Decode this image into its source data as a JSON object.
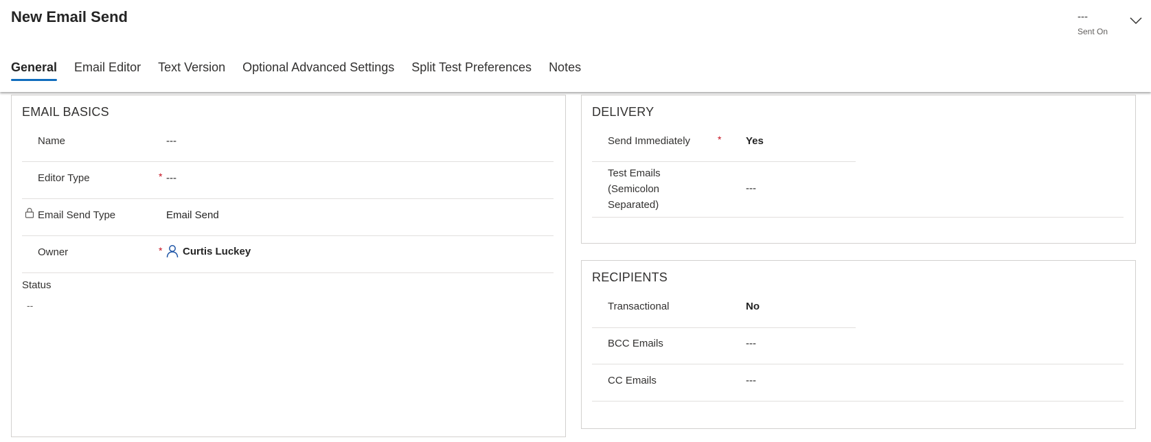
{
  "header": {
    "title": "New Email Send",
    "sent_on_value": "---",
    "sent_on_label": "Sent On",
    "expand_icon": "chevron-down-icon"
  },
  "tabs": [
    {
      "label": "General",
      "active": true
    },
    {
      "label": "Email Editor"
    },
    {
      "label": "Text Version"
    },
    {
      "label": "Optional Advanced Settings"
    },
    {
      "label": "Split Test Preferences"
    },
    {
      "label": "Notes"
    }
  ],
  "email_basics": {
    "title": "EMAIL BASICS",
    "name_label": "Name",
    "name_value": "---",
    "editor_type_label": "Editor Type",
    "editor_type_required": "*",
    "editor_type_value": "---",
    "email_send_type_label": "Email Send Type",
    "email_send_type_value": "Email Send",
    "owner_label": "Owner",
    "owner_required": "*",
    "owner_value": "Curtis Luckey",
    "status_label": "Status",
    "status_value": "--"
  },
  "delivery": {
    "title": "DELIVERY",
    "send_immediately_label": "Send Immediately",
    "send_immediately_required": "*",
    "send_immediately_value": "Yes",
    "test_emails_label_1": "Test Emails",
    "test_emails_label_2": "(Semicolon",
    "test_emails_label_3": "Separated)",
    "test_emails_value": "---"
  },
  "recipients": {
    "title": "RECIPIENTS",
    "transactional_label": "Transactional",
    "transactional_value": "No",
    "bcc_label": "BCC Emails",
    "bcc_value": "---",
    "cc_label": "CC Emails",
    "cc_value": "---"
  },
  "colors": {
    "accent": "#0f6cbd",
    "link": "#1e55a6",
    "required": "#c50f1f"
  }
}
